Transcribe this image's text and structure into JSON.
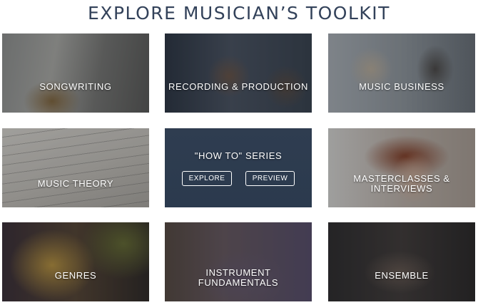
{
  "header": {
    "title": "EXPLORE MUSICIAN’S TOOLKIT"
  },
  "tiles": [
    {
      "label": "SONGWRITING"
    },
    {
      "label": "RECORDING & PRODUCTION"
    },
    {
      "label": "MUSIC BUSINESS"
    },
    {
      "label": "MUSIC THEORY"
    },
    {
      "label": "\"HOW TO\" SERIES",
      "buttons": {
        "explore": "EXPLORE",
        "preview": "PREVIEW"
      }
    },
    {
      "label": "MASTERCLASSES &\nINTERVIEWS"
    },
    {
      "label": "GENRES"
    },
    {
      "label": "INSTRUMENT\nFUNDAMENTALS"
    },
    {
      "label": "ENSEMBLE"
    }
  ],
  "colors": {
    "title": "#33425a",
    "how_to_tile": "#2f3d50",
    "text_on_tile": "#ffffff"
  }
}
